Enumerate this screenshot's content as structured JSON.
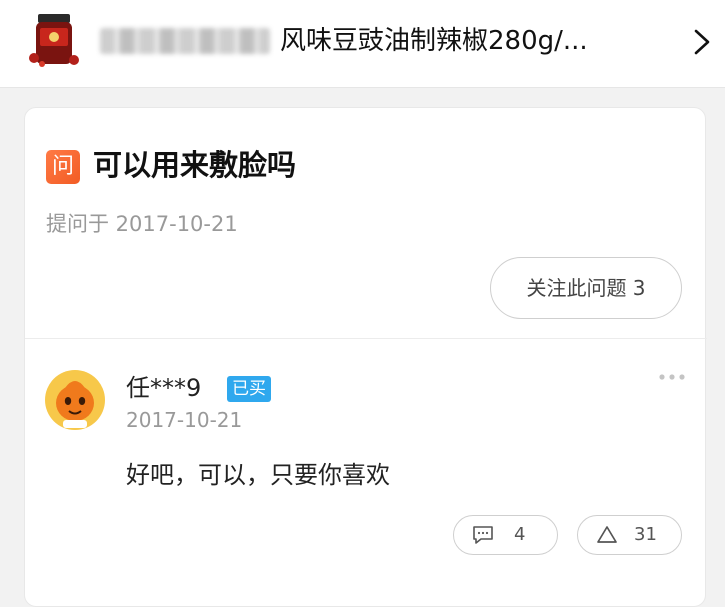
{
  "product": {
    "title": "风味豆豉油制辣椒280g/...",
    "thumb_icon": "product-jar-icon",
    "blurred_shop_name": ""
  },
  "question": {
    "badge": "问",
    "title": "可以用来敷脸吗",
    "date": "提问于 2017-10-21",
    "follow_label": "关注此问题 3"
  },
  "answer": {
    "username": "任***9",
    "bought_badge": "已买",
    "date": "2017-10-21",
    "text": "好吧，可以，只要你喜欢",
    "comment_count": "4",
    "like_count": "31"
  },
  "colors": {
    "accent_orange": "#f25c24",
    "bought_blue": "#2fa8ee"
  }
}
